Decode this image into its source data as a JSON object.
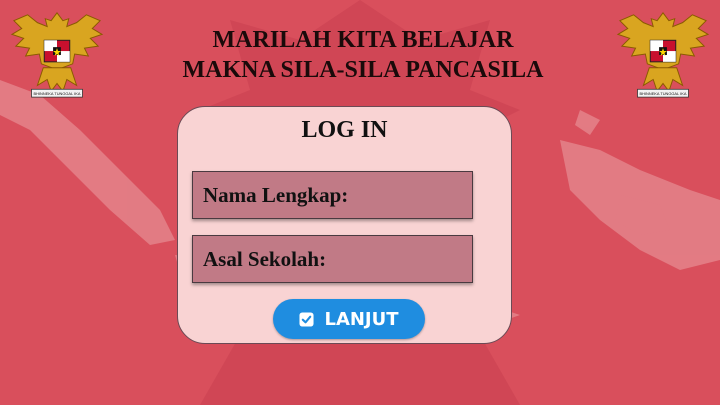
{
  "header": {
    "line1": "MARILAH KITA BELAJAR",
    "line2": "MAKNA SILA-SILA PANCASILA"
  },
  "emblem": {
    "left_icon": "garuda-pancasila-emblem",
    "right_icon": "garuda-pancasila-emblem",
    "motto": "BHINNEKA TUNGGAL IKA"
  },
  "login": {
    "title": "LOG IN",
    "name_label": "Nama Lengkap:",
    "school_label": "Asal Sekolah:",
    "button_label": "LANJUT",
    "button_icon": "checkbox-icon"
  },
  "colors": {
    "background": "#d94f5c",
    "card": "#f9d3d3",
    "field": "#c17a86",
    "button": "#1f8de0"
  }
}
